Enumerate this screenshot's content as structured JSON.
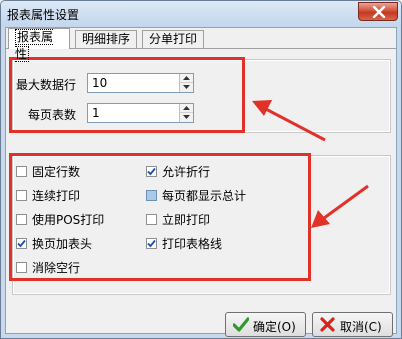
{
  "window": {
    "title": "报表属性设置"
  },
  "tabs": [
    {
      "label": "报表属性"
    },
    {
      "label": "明细排序"
    },
    {
      "label": "分单打印"
    }
  ],
  "fields": {
    "max_rows_label": "最大数据行",
    "max_rows_value": "10",
    "per_page_label": "每页表数",
    "per_page_value": "1"
  },
  "options": [
    {
      "label": "固定行数",
      "checked": false
    },
    {
      "label": "允许折行",
      "checked": true
    },
    {
      "label": "连续打印",
      "checked": false
    },
    {
      "label": "每页都显示总计",
      "checked": "mixed"
    },
    {
      "label": "使用POS打印",
      "checked": false
    },
    {
      "label": "立即打印",
      "checked": false
    },
    {
      "label": "换页加表头",
      "checked": true
    },
    {
      "label": "打印表格线",
      "checked": true
    },
    {
      "label": "消除空行",
      "checked": false
    }
  ],
  "buttons": {
    "ok_label": "确定(O)",
    "cancel_label": "取消(C)"
  },
  "colors": {
    "annotation": "#e1322a",
    "check": "#1e4ea3"
  },
  "icons": {
    "ok": "green-check-icon",
    "cancel": "red-x-icon",
    "close": "close-icon"
  }
}
